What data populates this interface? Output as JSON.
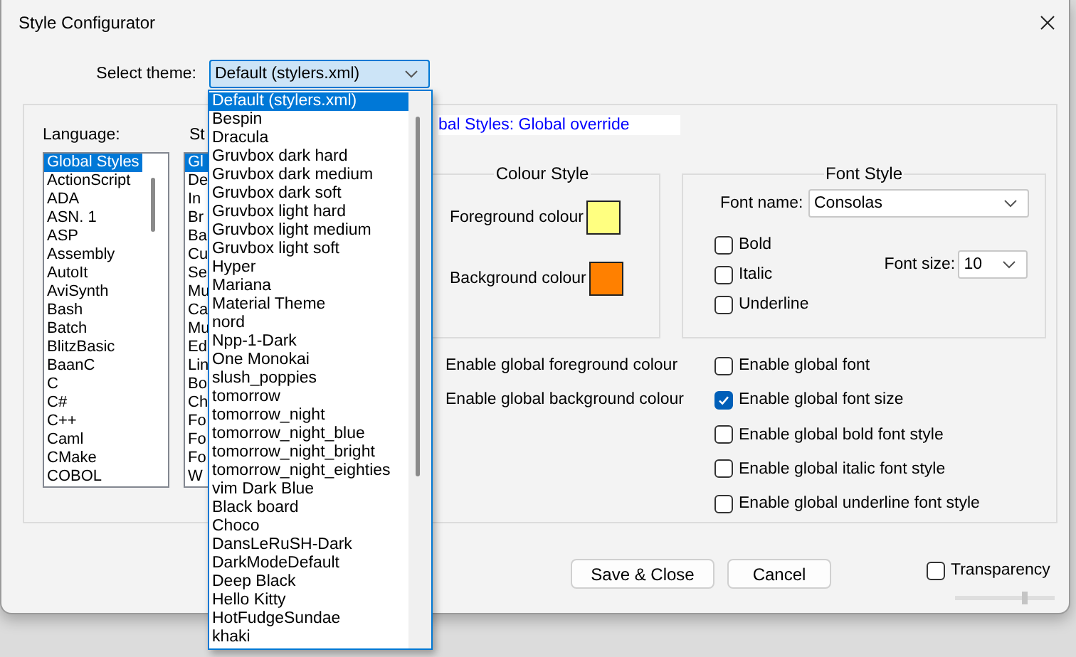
{
  "window": {
    "title": "Style Configurator"
  },
  "theme_select": {
    "label": "Select theme:",
    "value": "Default (stylers.xml)",
    "open": true
  },
  "theme_dropdown": {
    "items": [
      {
        "label": "Default (stylers.xml)",
        "selected": true
      },
      {
        "label": "Bespin",
        "selected": false
      },
      {
        "label": "Dracula",
        "selected": false
      },
      {
        "label": "Gruvbox dark hard",
        "selected": false
      },
      {
        "label": "Gruvbox dark medium",
        "selected": false
      },
      {
        "label": "Gruvbox dark soft",
        "selected": false
      },
      {
        "label": "Gruvbox light hard",
        "selected": false
      },
      {
        "label": "Gruvbox light medium",
        "selected": false
      },
      {
        "label": "Gruvbox light soft",
        "selected": false
      },
      {
        "label": "Hyper",
        "selected": false
      },
      {
        "label": "Mariana",
        "selected": false
      },
      {
        "label": "Material Theme",
        "selected": false
      },
      {
        "label": "nord",
        "selected": false
      },
      {
        "label": "Npp-1-Dark",
        "selected": false
      },
      {
        "label": "One Monokai",
        "selected": false
      },
      {
        "label": "slush_poppies",
        "selected": false
      },
      {
        "label": "tomorrow",
        "selected": false
      },
      {
        "label": "tomorrow_night",
        "selected": false
      },
      {
        "label": "tomorrow_night_blue",
        "selected": false
      },
      {
        "label": "tomorrow_night_bright",
        "selected": false
      },
      {
        "label": "tomorrow_night_eighties",
        "selected": false
      },
      {
        "label": "vim Dark Blue",
        "selected": false
      },
      {
        "label": "Black board",
        "selected": false
      },
      {
        "label": "Choco",
        "selected": false
      },
      {
        "label": "DansLeRuSH-Dark",
        "selected": false
      },
      {
        "label": "DarkModeDefault",
        "selected": false
      },
      {
        "label": "Deep Black",
        "selected": false
      },
      {
        "label": "Hello Kitty",
        "selected": false
      },
      {
        "label": "HotFudgeSundae",
        "selected": false
      },
      {
        "label": "khaki",
        "selected": false
      }
    ]
  },
  "language": {
    "label": "Language:",
    "items": [
      {
        "label": "Global Styles",
        "selected": true
      },
      {
        "label": "ActionScript",
        "selected": false
      },
      {
        "label": "ADA",
        "selected": false
      },
      {
        "label": "ASN. 1",
        "selected": false
      },
      {
        "label": "ASP",
        "selected": false
      },
      {
        "label": "Assembly",
        "selected": false
      },
      {
        "label": "AutoIt",
        "selected": false
      },
      {
        "label": "AviSynth",
        "selected": false
      },
      {
        "label": "Bash",
        "selected": false
      },
      {
        "label": "Batch",
        "selected": false
      },
      {
        "label": "BlitzBasic",
        "selected": false
      },
      {
        "label": "BaanC",
        "selected": false
      },
      {
        "label": "C",
        "selected": false
      },
      {
        "label": "C#",
        "selected": false
      },
      {
        "label": "C++",
        "selected": false
      },
      {
        "label": "Caml",
        "selected": false
      },
      {
        "label": "CMake",
        "selected": false
      },
      {
        "label": "COBOL",
        "selected": false
      }
    ]
  },
  "style": {
    "label": "St",
    "items": [
      {
        "label": "Gl",
        "selected": true
      },
      {
        "label": "De",
        "selected": false
      },
      {
        "label": "In",
        "selected": false
      },
      {
        "label": "Br",
        "selected": false
      },
      {
        "label": "Ba",
        "selected": false
      },
      {
        "label": "Cu",
        "selected": false
      },
      {
        "label": "Se",
        "selected": false
      },
      {
        "label": "Mu",
        "selected": false
      },
      {
        "label": "Ca",
        "selected": false
      },
      {
        "label": "Mu",
        "selected": false
      },
      {
        "label": "Ed",
        "selected": false
      },
      {
        "label": "Lin",
        "selected": false
      },
      {
        "label": "Bo",
        "selected": false
      },
      {
        "label": "Ch",
        "selected": false
      },
      {
        "label": "Fo",
        "selected": false
      },
      {
        "label": "Fo",
        "selected": false
      },
      {
        "label": "Fo",
        "selected": false
      },
      {
        "label": "W",
        "selected": false
      }
    ]
  },
  "header": "bal Styles: Global override",
  "colour_style": {
    "title": "Colour Style",
    "swatches": [
      {
        "label": "Foreground colour",
        "color": "#ffff80"
      },
      {
        "label": "Background colour",
        "color": "#ff8000"
      }
    ]
  },
  "font_style": {
    "title": "Font Style",
    "font_name": {
      "label": "Font name:",
      "value": "Consolas"
    },
    "checks": [
      {
        "label": "Bold",
        "checked": false
      },
      {
        "label": "Italic",
        "checked": false
      },
      {
        "label": "Underline",
        "checked": false
      }
    ],
    "font_size": {
      "label": "Font size:",
      "value": "10"
    }
  },
  "colour_enables": [
    {
      "label": "Enable global foreground colour"
    },
    {
      "label": "Enable global background colour"
    }
  ],
  "font_enables": [
    {
      "label": "Enable global font",
      "checked": false
    },
    {
      "label": "Enable global font size",
      "checked": true
    },
    {
      "label": "Enable global bold font style",
      "checked": false
    },
    {
      "label": "Enable global italic font style",
      "checked": false
    },
    {
      "label": "Enable global underline font style",
      "checked": false
    }
  ],
  "buttons": [
    {
      "label": "Save & Close"
    },
    {
      "label": "Cancel"
    }
  ],
  "transparency": {
    "label": "Transparency",
    "checked": false
  },
  "slider": {
    "level": 0.7
  }
}
